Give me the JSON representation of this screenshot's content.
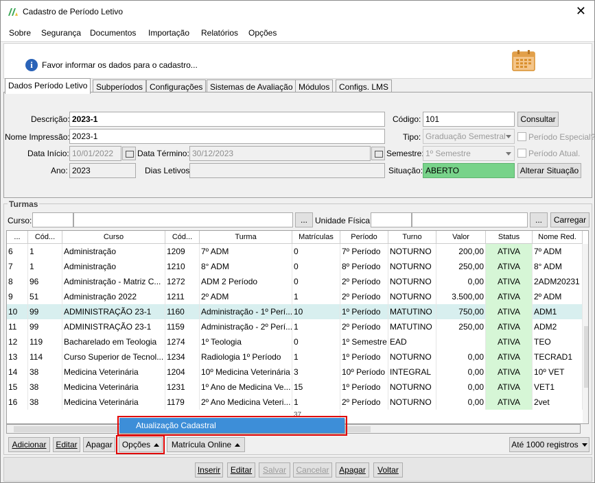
{
  "window": {
    "title": "Cadastro de Período Letivo",
    "close": "✕"
  },
  "menu": [
    "Sobre",
    "Segurança",
    "Documentos",
    "Importação",
    "Relatórios",
    "Opções"
  ],
  "info": {
    "text": "Favor informar os dados para o cadastro..."
  },
  "tabs": [
    "Dados Período Letivo",
    "Subperíodos",
    "Configurações",
    "Sistemas de Avaliação",
    "Módulos",
    "Configs. LMS"
  ],
  "form": {
    "descricao_label": "Descrição:",
    "descricao": "2023-1",
    "nome_impressao_label": "Nome Impressão:",
    "nome_impressao": "2023-1",
    "data_inicio_label": "Data Início:",
    "data_inicio": "10/01/2022",
    "data_termino_label": "Data Término:",
    "data_termino": "30/12/2023",
    "ano_label": "Ano:",
    "ano": "2023",
    "dias_letivos_label": "Dias Letivos",
    "codigo_label": "Código:",
    "codigo": "101",
    "consultar": "Consultar",
    "tipo_label": "Tipo:",
    "tipo": "Graduação Semestral",
    "periodo_especial": "Período Especial?",
    "semestre_label": "Semestre:",
    "semestre": "1º Semestre",
    "periodo_atual": "Período Atual.",
    "situacao_label": "Situação:",
    "situacao": "ABERTO",
    "alterar_situacao": "Alterar Situação",
    "situacao_color": "#78d38a"
  },
  "turmas": {
    "group_label": "Turmas",
    "curso_label": "Curso:",
    "unidade_label": "Unidade Física:",
    "ellipsis": "...",
    "carregar": "Carregar",
    "columns": [
      "...",
      "Cód...",
      "Curso",
      "Cód...",
      "Turma",
      "Matrículas",
      "Período",
      "Turno",
      "Valor",
      "Status",
      "Nome Red."
    ],
    "rows": [
      [
        "6",
        "1",
        "Administração",
        "1209",
        "7º ADM",
        "0",
        "7º Período",
        "NOTURNO",
        "200,00",
        "ATIVA",
        "7º ADM"
      ],
      [
        "7",
        "1",
        "Administração",
        "1210",
        "8° ADM",
        "0",
        "8º Período",
        "NOTURNO",
        "250,00",
        "ATIVA",
        "8° ADM"
      ],
      [
        "8",
        "96",
        "Administração - Matriz C...",
        "1272",
        "ADM 2 Período",
        "0",
        "2º Período",
        "NOTURNO",
        "0,00",
        "ATIVA",
        "2ADM20231"
      ],
      [
        "9",
        "51",
        "Administração 2022",
        "1211",
        "2º ADM",
        "1",
        "2º Período",
        "NOTURNO",
        "3.500,00",
        "ATIVA",
        "2º ADM"
      ],
      [
        "10",
        "99",
        "ADMINISTRAÇÃO 23-1",
        "1160",
        "Administração - 1º Perí...",
        "10",
        "1º Período",
        "MATUTINO",
        "750,00",
        "ATIVA",
        "ADM1"
      ],
      [
        "11",
        "99",
        "ADMINISTRAÇÃO 23-1",
        "1159",
        "Administração - 2º Perí...",
        "1",
        "2º Período",
        "MATUTINO",
        "250,00",
        "ATIVA",
        "ADM2"
      ],
      [
        "12",
        "119",
        "Bacharelado em Teologia",
        "1274",
        "1º Teologia",
        "0",
        "1º Semestre",
        "EAD",
        "",
        "ATIVA",
        "TEO"
      ],
      [
        "13",
        "114",
        "Curso Superior de Tecnol...",
        "1234",
        "Radiologia 1º Período",
        "1",
        "1º Período",
        "NOTURNO",
        "0,00",
        "ATIVA",
        "TECRAD1"
      ],
      [
        "14",
        "38",
        "Medicina Veterinária",
        "1204",
        "10º  Medicina Veterinária",
        "3",
        "10º Período",
        "INTEGRAL",
        "0,00",
        "ATIVA",
        "10º VET"
      ],
      [
        "15",
        "38",
        "Medicina Veterinária",
        "1231",
        "1º Ano de Medicina Ve...",
        "15",
        "1º Período",
        "NOTURNO",
        "0,00",
        "ATIVA",
        "VET1"
      ],
      [
        "16",
        "38",
        "Medicina Veterinária",
        "1179",
        "2º Ano Medicina Veteri...",
        "1",
        "2º Período",
        "NOTURNO",
        "0,00",
        "ATIVA",
        "2vet"
      ]
    ],
    "total": "37"
  },
  "popup": {
    "item": "Atualização Cadastral"
  },
  "actions": {
    "adicionar": "Adicionar",
    "editar": "Editar",
    "apagar": "Apagar",
    "opcoes": "Opções",
    "matricula_online": "Matrícula Online",
    "ate_registros": "Até 1000 registros"
  },
  "bottom": {
    "inserir": "Inserir",
    "editar": "Editar",
    "salvar": "Salvar",
    "cancelar": "Cancelar",
    "apagar": "Apagar",
    "voltar": "Voltar"
  }
}
